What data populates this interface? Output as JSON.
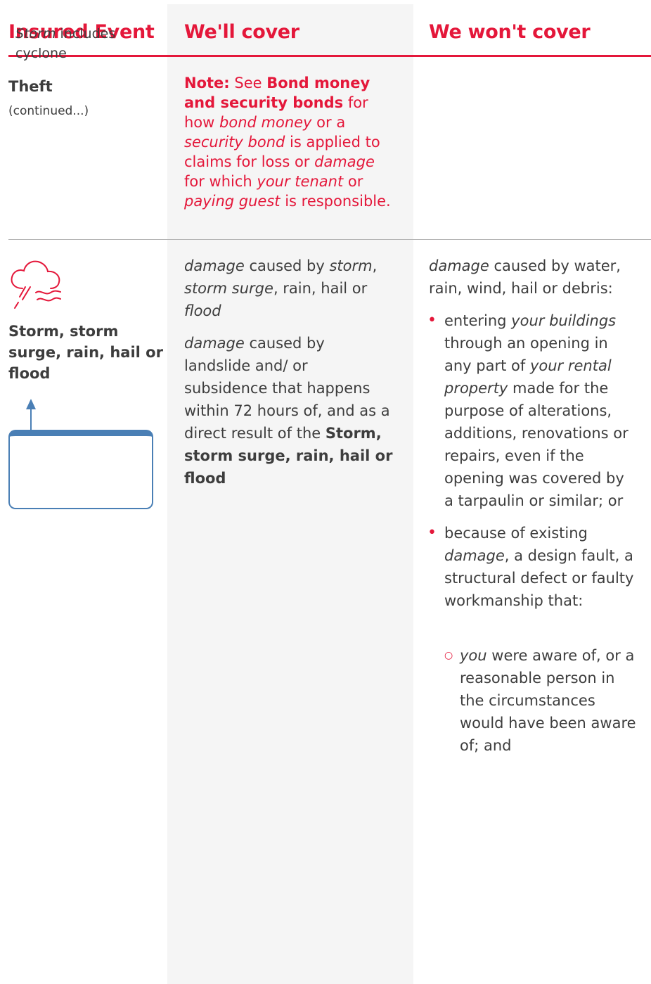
{
  "headers": {
    "insured_event": "Insured Event",
    "we_cover": "We'll cover",
    "we_wont_cover": "We won't cover"
  },
  "theft": {
    "title": "Theft",
    "subtitle": "(continued...)",
    "note": {
      "label": "Note:",
      "t1": " See ",
      "b1": "Bond money and security bonds",
      "t2": " for how ",
      "i1": "bond money",
      "t3": " or a ",
      "i2": "security bond",
      "t4": " is applied to claims for loss or ",
      "i3": "damage",
      "t5": " for which ",
      "i4": "your tenant",
      "t6": " or ",
      "i5": "paying guest",
      "t7": " is responsible."
    }
  },
  "storm": {
    "icon": "storm-cloud-icon",
    "title": "Storm, storm surge, rain, hail or flood",
    "callout": {
      "i": "Storm",
      "t": " includes cyclone"
    },
    "cover": {
      "p1": {
        "i1": "damage",
        "t1": " caused by ",
        "i2": "storm",
        "t2": ", ",
        "i3": "storm surge",
        "t3": ", rain, hail or ",
        "i4": "flood"
      },
      "p2": {
        "i1": "damage",
        "t1": " caused by landslide and/ or subsidence that happens within 72 hours of, and as a direct result of the ",
        "b1": "Storm, storm surge, rain, hail or flood"
      }
    },
    "wont": {
      "intro": {
        "i1": "damage",
        "t1": " caused by water, rain, wind, hail or debris:"
      },
      "b1": {
        "t1": "entering ",
        "i1": "your buildings",
        "t2": " through an opening in any part of ",
        "i2": "your rental property",
        "t3": " made for the purpose of alterations, additions, renovations or repairs, even if the opening was covered by a tarpaulin or similar; or"
      },
      "b2": {
        "t1": "because of existing ",
        "i1": "damage",
        "t2": ", a design fault, a structural defect or faulty workmanship that:"
      },
      "b2a": {
        "i1": "you",
        "t1": " were aware of, or a reasonable person in the circumstances would have been aware of; and"
      }
    }
  }
}
